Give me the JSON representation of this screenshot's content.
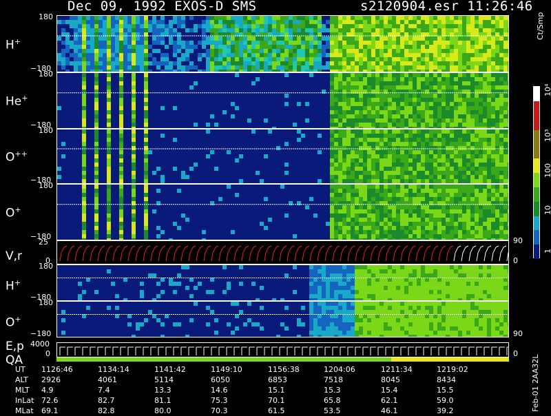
{
  "header": {
    "left": "Dec 09, 1992   EXOS-D SMS",
    "right": "s2120904.esr  11:26:46"
  },
  "colorbar": {
    "title": "Ct/Smp",
    "ticks": [
      "10⁴",
      "10³",
      "100",
      "10",
      "1"
    ]
  },
  "chart_data": {
    "type": "heatmap",
    "title": "Dec 09, 1992   EXOS-D SMS",
    "panels": [
      {
        "label": "H",
        "charge": "+",
        "ymax": "180",
        "ymin": "−180"
      },
      {
        "label": "He",
        "charge": "+",
        "ymax": "180",
        "ymin": "−180"
      },
      {
        "label": "O",
        "charge": "++",
        "ymax": "180",
        "ymin": "−180"
      },
      {
        "label": "O",
        "charge": "+",
        "ymax": "180",
        "ymin": "−180"
      },
      {
        "label": "V,r",
        "ymax": "25",
        "ymin": "0",
        "right_max": "90",
        "right_min": "0"
      },
      {
        "label": "H",
        "charge": "+",
        "ymax": "180",
        "ymin": "−180"
      },
      {
        "label": "O",
        "charge": "+",
        "ymax": "180",
        "ymin": "−180",
        "right_min": "90"
      },
      {
        "label": "E,p",
        "label2": "QA",
        "ymax": "4000",
        "ymin": "0",
        "right_min": "0"
      }
    ],
    "axis_rows": {
      "UT": [
        "1126:46",
        "1134:14",
        "1141:42",
        "1149:10",
        "1156:38",
        "1204:06",
        "1211:34",
        "1219:02"
      ],
      "ALT": [
        "2926",
        "4061",
        "5114",
        "6050",
        "6853",
        "7518",
        "8045",
        "8434"
      ],
      "MLT": [
        "4.9",
        "7.4",
        "13.3",
        "14.6",
        "15.1",
        "15.3",
        "15.4",
        "15.5"
      ],
      "InLat": [
        "72.6",
        "82.7",
        "81.1",
        "75.3",
        "70.1",
        "65.8",
        "62.1",
        "59.0"
      ],
      "MLat": [
        "69.1",
        "82.8",
        "80.0",
        "70.3",
        "61.5",
        "53.5",
        "46.1",
        "39.2"
      ]
    },
    "colorbar_scale": "log",
    "colorbar_range": [
      1,
      10000
    ]
  },
  "footer": {
    "id": "Feb-01 2AA32L"
  }
}
